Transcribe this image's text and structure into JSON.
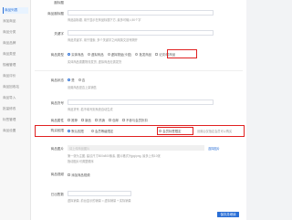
{
  "sidebar": {
    "items": [
      {
        "label": "商品列表"
      },
      {
        "label": "添加商品"
      },
      {
        "label": "商品分类"
      },
      {
        "label": "商品品牌"
      },
      {
        "label": "商品类型"
      },
      {
        "label": "规格管理"
      },
      {
        "label": "商品评价"
      },
      {
        "label": "商品回收站"
      },
      {
        "label": "商品导入"
      },
      {
        "label": "批量修改"
      },
      {
        "label": "标签管理"
      },
      {
        "label": "商品设置"
      }
    ]
  },
  "form": {
    "top_label": "副标题",
    "name_label": "商品副标题",
    "name_hint": "商品副标题, 用于显示在商品标题下方, 最多可输入50个字",
    "keywords_label": "关键字",
    "keywords_hint": "商品关键字, 用于搜索, 多个关键字之间用英文逗号隔开",
    "type_label": "商品类型",
    "type_options": [
      "实体商品",
      "虚拟商品",
      "虚拟物品(卡密)",
      "批发商品"
    ],
    "type_extra": "记次/时商品",
    "type_hint": "实体商品需要物流发货, 虚拟商品无需发货",
    "status_label": "商品状态",
    "status_options": [
      "是",
      "否"
    ],
    "status_hint": "设置商品是否上架销售",
    "sku_label": "商品货号",
    "sku_hint": "商品货号, 若不填写则系统自动生成",
    "attr_label": "商品属性",
    "attr_options": [
      "推荐",
      "新品",
      "热销",
      "包邮",
      "不参与会员折扣"
    ],
    "delivery_label": "购买权限",
    "delivery_options": [
      "默认权限",
      "会员等级限定",
      "会员标签限定"
    ],
    "delivery_hint": "设置后仅指定会员可以购买",
    "image_label": "商品图片",
    "image_placeholder": "请上传商品图片",
    "image_button": "选择图片",
    "image_hint_1": "第一张为主图, 建议尺寸800x800像素, 图片格式为jpg/png, 最多上传10张",
    "image_hint_2": "拖动图片可调整顺序",
    "video_label": "商品视频",
    "video_check": "添加商品视频",
    "sales_label": "已出售数",
    "sales_hint": "虚拟销量, 前台显示的销量 = 虚拟销量 + 实际销量",
    "save_button": "保存并继续"
  }
}
